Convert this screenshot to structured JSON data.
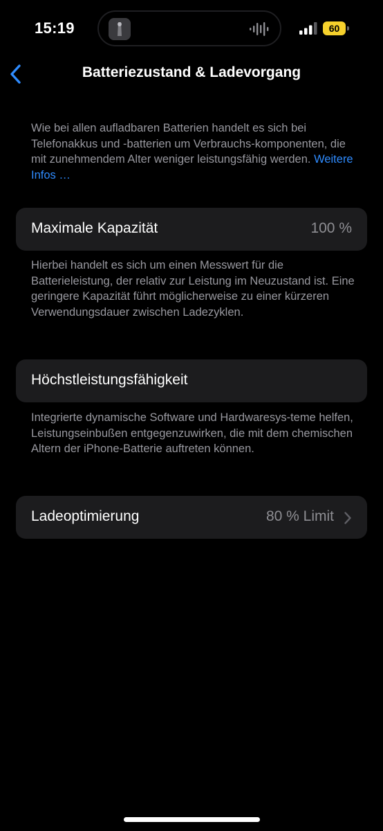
{
  "status_bar": {
    "time": "15:19",
    "battery_level": "60",
    "battery_color": "#f6d12c"
  },
  "nav": {
    "title": "Batteriezustand & Ladevorgang",
    "back_icon": "chevron-left-icon"
  },
  "intro": {
    "text": "Wie bei allen aufladbaren Batterien handelt es sich bei Telefonakkus und -batterien um Verbrauchs-komponenten, die mit zunehmendem Alter weniger leistungsfähig werden.",
    "link_label": "Weitere Infos …"
  },
  "max_capacity": {
    "label": "Maximale Kapazität",
    "value": "100 %",
    "footnote": "Hierbei handelt es sich um einen Messwert für die Batterieleistung, der relativ zur Leistung im Neuzustand ist. Eine geringere Kapazität führt möglicherweise zu einer kürzeren Verwendungsdauer zwischen Ladezyklen."
  },
  "peak_performance": {
    "label": "Höchstleistungsfähigkeit",
    "footnote": "Integrierte dynamische Software und Hardwaresys-teme helfen, Leistungseinbußen entgegenzuwirken, die mit dem chemischen Altern der iPhone-Batterie auftreten können."
  },
  "charging_optimization": {
    "label": "Ladeoptimierung",
    "value": "80 % Limit"
  },
  "colors": {
    "accent": "#2f8cff",
    "cell_background": "#1c1c1e",
    "secondary_text": "#98989f"
  }
}
